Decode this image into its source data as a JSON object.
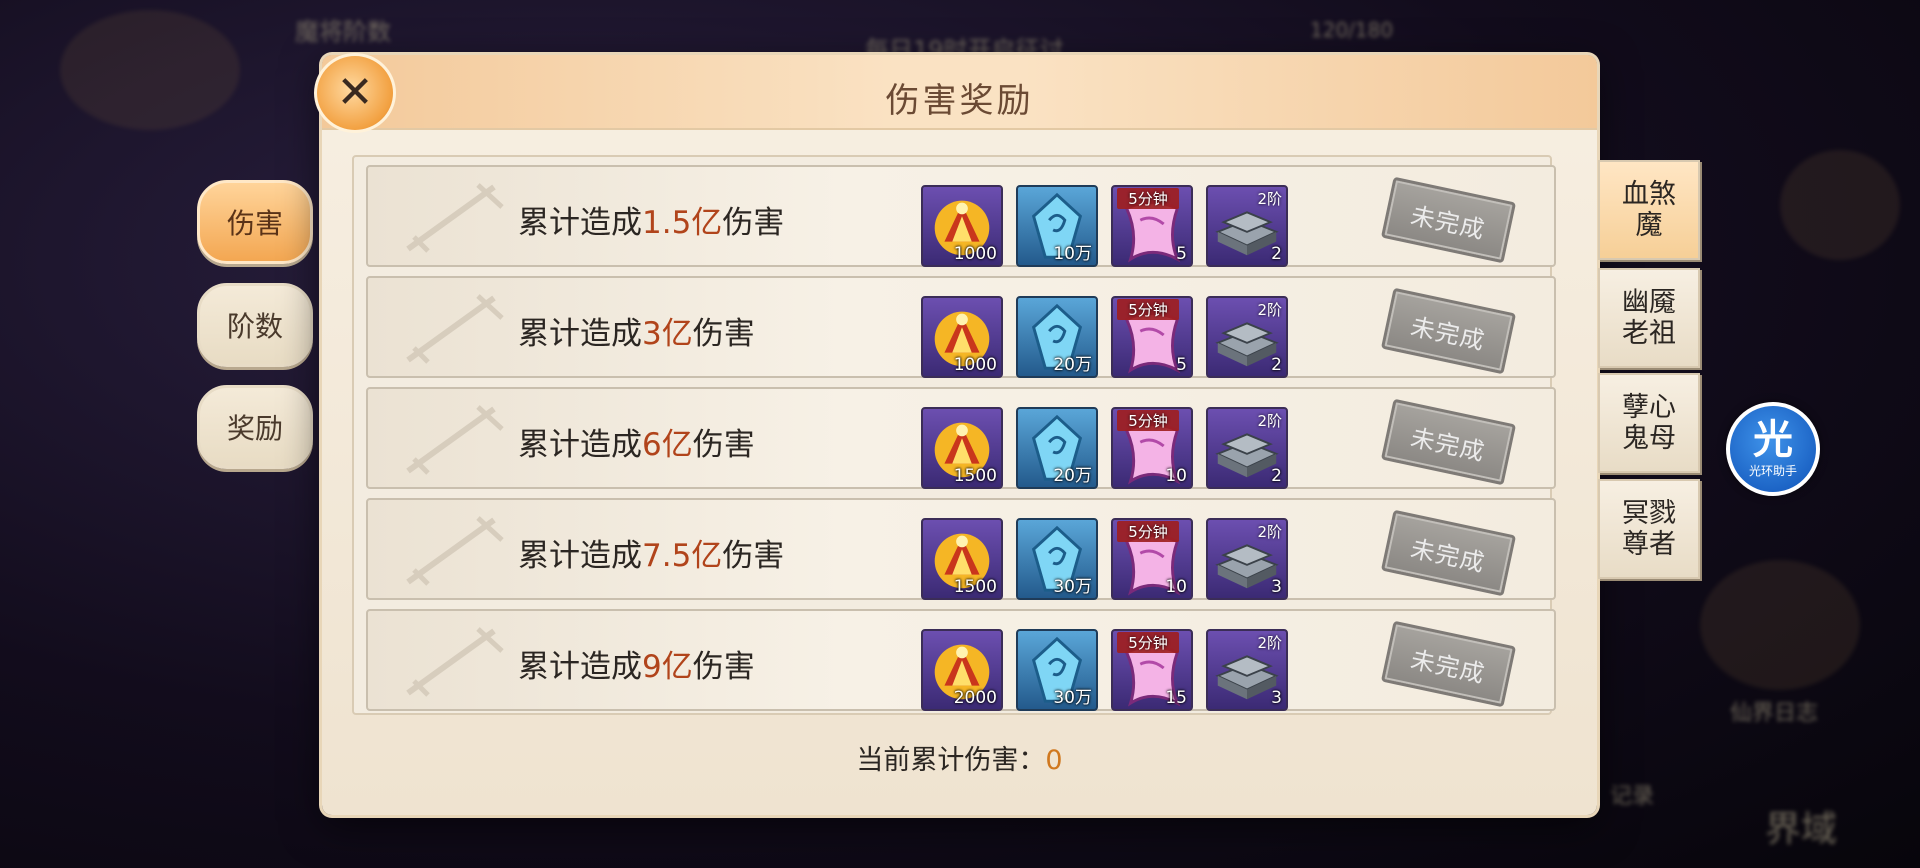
{
  "background": {
    "top_left_label": "魔将阶数",
    "top_center_label": "每日19时开启征讨",
    "top_counter": "120/180",
    "right_labels": [
      "仙界日志",
      "记录",
      "界域"
    ]
  },
  "modal": {
    "title": "伤害奖励",
    "close_icon": "close-icon",
    "footer_label": "当前累计伤害：",
    "footer_value": "0"
  },
  "left_tabs": [
    {
      "label": "伤害",
      "active": true
    },
    {
      "label": "阶数",
      "active": false
    },
    {
      "label": "奖励",
      "active": false
    }
  ],
  "right_tabs": [
    {
      "line1": "血煞",
      "line2": "魔",
      "active": true
    },
    {
      "line1": "幽魇",
      "line2": "老祖",
      "active": false
    },
    {
      "line1": "孽心",
      "line2": "鬼母",
      "active": false
    },
    {
      "line1": "冥戮",
      "line2": "尊者",
      "active": false
    }
  ],
  "rows": [
    {
      "prefix": "累计造成",
      "amount": "1.5亿",
      "suffix": "伤害",
      "rewards": [
        {
          "icon": "gold-crest-icon",
          "qty": "1000"
        },
        {
          "icon": "blue-crystal-icon",
          "qty": "10万"
        },
        {
          "icon": "pink-scroll-icon",
          "tag": "5分钟",
          "qty": "5"
        },
        {
          "icon": "iron-ingot-icon",
          "tag": "2阶",
          "qty": "2"
        }
      ],
      "status": "未完成"
    },
    {
      "prefix": "累计造成",
      "amount": "3亿",
      "suffix": "伤害",
      "rewards": [
        {
          "icon": "gold-crest-icon",
          "qty": "1000"
        },
        {
          "icon": "blue-crystal-icon",
          "qty": "20万"
        },
        {
          "icon": "pink-scroll-icon",
          "tag": "5分钟",
          "qty": "5"
        },
        {
          "icon": "iron-ingot-icon",
          "tag": "2阶",
          "qty": "2"
        }
      ],
      "status": "未完成"
    },
    {
      "prefix": "累计造成",
      "amount": "6亿",
      "suffix": "伤害",
      "rewards": [
        {
          "icon": "gold-crest-icon",
          "qty": "1500"
        },
        {
          "icon": "blue-crystal-icon",
          "qty": "20万"
        },
        {
          "icon": "pink-scroll-icon",
          "tag": "5分钟",
          "qty": "10"
        },
        {
          "icon": "iron-ingot-icon",
          "tag": "2阶",
          "qty": "2"
        }
      ],
      "status": "未完成"
    },
    {
      "prefix": "累计造成",
      "amount": "7.5亿",
      "suffix": "伤害",
      "rewards": [
        {
          "icon": "gold-crest-icon",
          "qty": "1500"
        },
        {
          "icon": "blue-crystal-icon",
          "qty": "30万"
        },
        {
          "icon": "pink-scroll-icon",
          "tag": "5分钟",
          "qty": "10"
        },
        {
          "icon": "iron-ingot-icon",
          "tag": "2阶",
          "qty": "3"
        }
      ],
      "status": "未完成"
    },
    {
      "prefix": "累计造成",
      "amount": "9亿",
      "suffix": "伤害",
      "rewards": [
        {
          "icon": "gold-crest-icon",
          "qty": "2000"
        },
        {
          "icon": "blue-crystal-icon",
          "qty": "30万"
        },
        {
          "icon": "pink-scroll-icon",
          "tag": "5分钟",
          "qty": "15"
        },
        {
          "icon": "iron-ingot-icon",
          "tag": "2阶",
          "qty": "3"
        }
      ],
      "status": "未完成"
    }
  ],
  "helper": {
    "glyph": "光",
    "label": "光环助手"
  }
}
